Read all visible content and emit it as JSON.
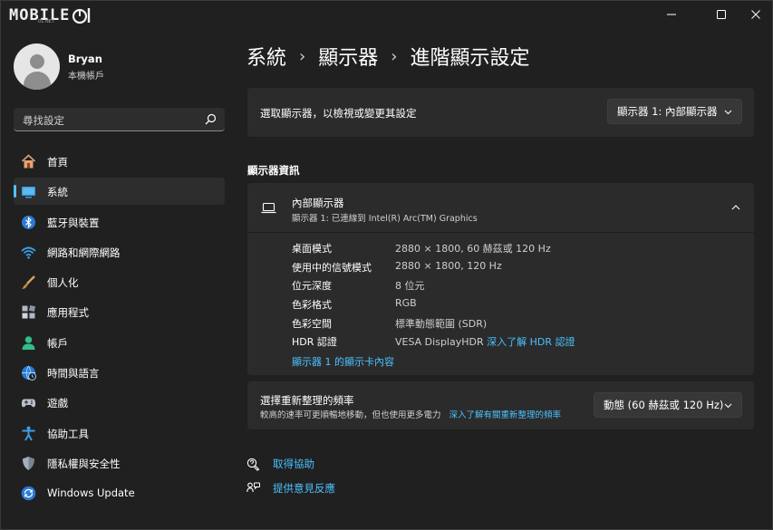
{
  "window": {
    "logo_text": "MOBILE",
    "logo_sub": "01.NET"
  },
  "profile": {
    "name": "Bryan",
    "account_type": "本機帳戶"
  },
  "search": {
    "placeholder": "尋找設定"
  },
  "sidebar": {
    "items": [
      {
        "label": "首頁",
        "icon": "home-icon"
      },
      {
        "label": "系統",
        "icon": "system-icon",
        "active": true
      },
      {
        "label": "藍牙與裝置",
        "icon": "bluetooth-icon"
      },
      {
        "label": "網路和網際網路",
        "icon": "network-icon"
      },
      {
        "label": "個人化",
        "icon": "brush-icon"
      },
      {
        "label": "應用程式",
        "icon": "apps-icon"
      },
      {
        "label": "帳戶",
        "icon": "account-icon"
      },
      {
        "label": "時間與語言",
        "icon": "time-language-icon"
      },
      {
        "label": "遊戲",
        "icon": "gaming-icon"
      },
      {
        "label": "協助工具",
        "icon": "accessibility-icon"
      },
      {
        "label": "隱私權與安全性",
        "icon": "shield-icon"
      },
      {
        "label": "Windows Update",
        "icon": "update-icon"
      }
    ]
  },
  "breadcrumb": {
    "items": [
      "系統",
      "顯示器",
      "進階顯示設定"
    ],
    "separator": "›"
  },
  "select_display": {
    "label": "選取顯示器，以檢視或變更其設定",
    "value": "顯示器 1: 內部顯示器"
  },
  "display_info": {
    "section_title": "顯示器資訊",
    "title": "內部顯示器",
    "subtitle": "顯示器 1: 已連線到 Intel(R) Arc(TM) Graphics",
    "rows": [
      {
        "key": "桌面模式",
        "value": "2880 × 1800, 60 赫茲或 120 Hz"
      },
      {
        "key": "使用中的信號模式",
        "value": "2880 × 1800, 120 Hz"
      },
      {
        "key": "位元深度",
        "value": "8 位元"
      },
      {
        "key": "色彩格式",
        "value": "RGB"
      },
      {
        "key": "色彩空間",
        "value": "標準動態範圍 (SDR)"
      },
      {
        "key": "HDR 認證",
        "value": "VESA DisplayHDR",
        "link": "深入了解 HDR 認證"
      }
    ],
    "adapter_link": "顯示器 1 的顯示卡內容"
  },
  "refresh_rate": {
    "title": "選擇重新整理的頻率",
    "description": "較高的速率可更順暢地移動，但也使用更多電力",
    "link": "深入了解有關重新整理的頻率",
    "value": "動態 (60 赫茲或 120 Hz)"
  },
  "help": {
    "get_help": "取得協助",
    "feedback": "提供意見反應"
  },
  "colors": {
    "accent": "#4cc2ff",
    "background": "#202020",
    "card": "#2b2b2b"
  }
}
